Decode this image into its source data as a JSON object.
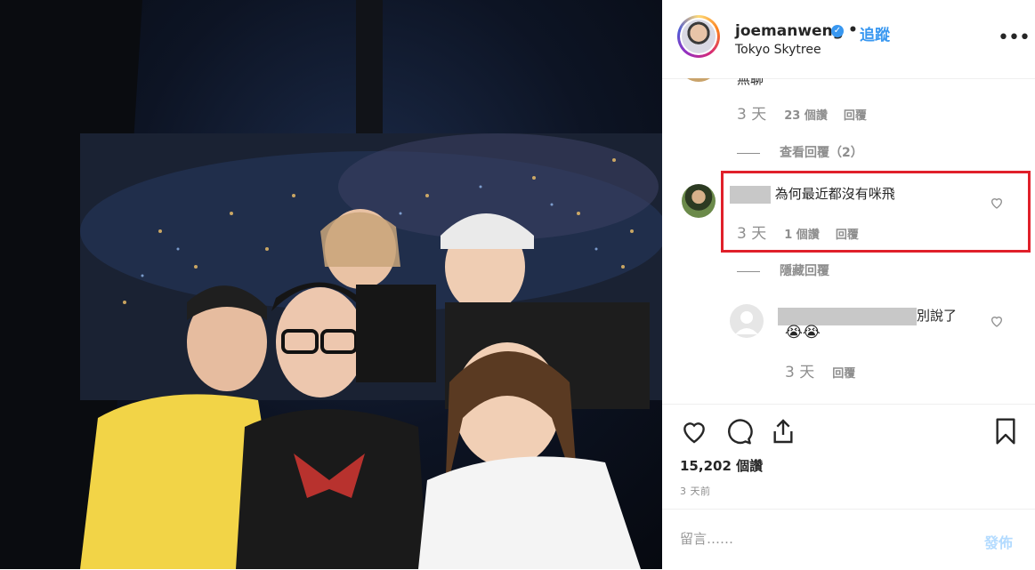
{
  "post": {
    "username": "joemanweng",
    "separator": "•",
    "follow_label": "追蹤",
    "location": "Tokyo Skytree",
    "more_label": "•••"
  },
  "comments": {
    "partial_text": "無聊",
    "first_meta": {
      "time": "3 天",
      "likes": "23 個讚",
      "reply": "回覆"
    },
    "view_replies_label": "查看回覆（2）",
    "highlighted": {
      "text": "為何最近都沒有咪飛",
      "time": "3 天",
      "likes": "1 個讚",
      "reply": "回覆"
    },
    "hide_replies_label": "隱藏回覆",
    "reply_comment": {
      "text": "別說了",
      "emoji": "😭😭",
      "time": "3 天",
      "reply": "回覆"
    }
  },
  "actions": {
    "likes_count": "15,202 個讚",
    "posted_time": "3 天前"
  },
  "add_comment": {
    "placeholder": "留言……",
    "post_label": "發佈"
  },
  "colors": {
    "accent": "#3897f0",
    "highlight": "#e0202a",
    "muted": "#8e8e8e",
    "post_disabled": "#b3dbff"
  },
  "icons": [
    "verified-icon",
    "more-options-icon",
    "heart-icon",
    "comment-icon",
    "share-icon",
    "bookmark-icon"
  ]
}
